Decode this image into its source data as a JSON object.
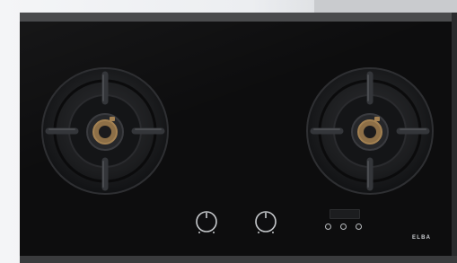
{
  "product": {
    "brand": "ELBA"
  },
  "appliance": {
    "burners": [
      {
        "id": "left-burner"
      },
      {
        "id": "right-burner"
      }
    ],
    "knobs": [
      {
        "id": "left-knob"
      },
      {
        "id": "right-knob"
      }
    ],
    "timer_buttons": [
      {
        "id": "timer-button-1"
      },
      {
        "id": "timer-button-2"
      },
      {
        "id": "timer-button-3"
      }
    ]
  },
  "colors": {
    "glass": "#0d0d0e",
    "frame": "#4a4b4d",
    "grate": "#1f2022",
    "brass": "#a38152",
    "wall": "#eceef1"
  }
}
